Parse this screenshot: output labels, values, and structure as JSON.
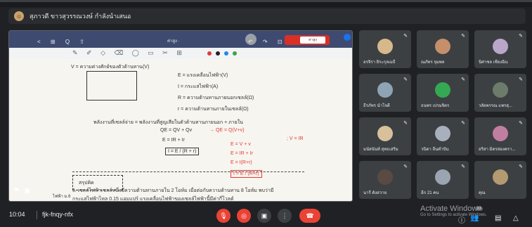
{
  "header": {
    "name": "สุภาวดี ขาวสุวรรณวงษ์ กำลังนำเสนอ"
  },
  "tablet": {
    "title": "ค่าสูง ·",
    "tab": "ค่าสูง",
    "nav_left": "< ⊞ Q ⇧",
    "nav_right": "↶ ↷ ⊡ ✕ ⋯"
  },
  "whiteboard": {
    "l1": "V =  ความต่างศักย์ของตัวต้านทาน(V)",
    "l2": "E = แรงเคลื่อนไฟฟ้า(V)",
    "l3": "I = กระแสไฟฟ้า(A)",
    "l4": "R = ความต้านทานภายนอกเซลล์(Ω)",
    "l5": "r = ความต้านทานภายในเซลล์(Ω)",
    "l6": "พลังงานที่เซลล์จ่าย = พลังงานที่สูญเสียในตัวต้านทานภายนอก + ภายใน",
    "eq1": "QE = QV + Qv",
    "eq1r": "→ QE = Q(V+v)",
    "eq2": "E = IR + Ir",
    "eq3": "I = E / (R + r)",
    "r1": "E = V + v",
    "r2": "E = IR + Ir",
    "r3": "E = I(R+r)",
    "r4": "I = E / (R+r)",
    "r5": "; V = IR",
    "box_label": "สรุปคิด",
    "bottom1": "5.  เซลล์ไฟฟ้าเซลล์หนึ่งมีความต้านทานภายใน 2 โอห์ม เมื่อต่อกับความต้านทาน 8 โอห์ม พบว่ามี",
    "bottom2": "กระแสไฟฟ้าไหล 0.15 แอมแปร์ แรงเคลื่อนไฟฟ้าของเซลล์ไฟฟ้านี้มีค่ากี่โวลต์",
    "overlay_label": "ไฟฟ้า ม.6"
  },
  "participants": [
    {
      "name": "อรจิรา ยิระกุลเมธี",
      "color": "#d6b88a"
    },
    {
      "name": "ณภัทร จุมพล",
      "color": "#c48f6a"
    },
    {
      "name": "นิศาชล เชียงฉิน",
      "color": "#b9a7c9"
    },
    {
      "name": "ธีรภัทร นำโจดี",
      "color": "#8ea4b5"
    },
    {
      "name": "ธนพร เปรมจิตร",
      "color": "#34a853"
    },
    {
      "name": "วลัยพรรณ แพรสุ...",
      "color": "#6d7b6a"
    },
    {
      "name": "มนัสนันท์ สุทธเสริม",
      "color": "#d7c09a"
    },
    {
      "name": "วนิดา ลีนคำปัน",
      "color": "#a9b0bd"
    },
    {
      "name": "อริสา มิตรสองครา...",
      "color": "#c07fa0"
    },
    {
      "name": "นารี ดังสวาย",
      "color": "#5a4a44"
    },
    {
      "name": "อีก 21 คน",
      "color": "#9aa5b1"
    },
    {
      "name": "คุณ",
      "color": "#b39a70"
    }
  ],
  "bottombar": {
    "time": "10:04",
    "meeting_code": "fjk-fnqy-nfx",
    "badge": "33",
    "activate_title": "Activate Windows",
    "activate_sub": "Go to Settings to activate Windows."
  },
  "colors": {
    "end_call": "#ea4335",
    "mute": "#ea4335",
    "present": "#8ab4f8"
  }
}
